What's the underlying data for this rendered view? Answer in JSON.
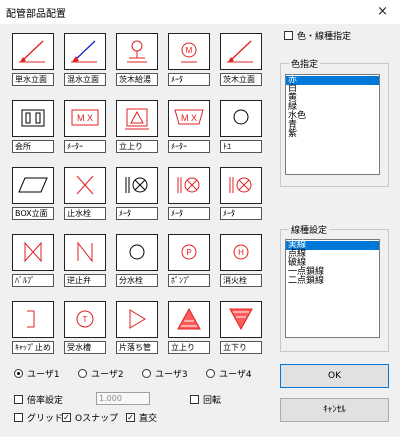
{
  "window": {
    "title": "配管部品配置",
    "close_glyph": "×"
  },
  "parts": [
    {
      "label": "単水立面",
      "icon": "diagonal-pipe-blue-icon"
    },
    {
      "label": "混水立面",
      "icon": "diagonal-pipe-mixed-icon"
    },
    {
      "label": "茨木給湯",
      "icon": "water-heater-icon"
    },
    {
      "label": "ﾒｰﾀ",
      "icon": "meter-circle-m-icon"
    },
    {
      "label": "茨木立面",
      "icon": "diagonal-pipe-red-icon"
    },
    {
      "label": "会所",
      "icon": "catch-basin-icon"
    },
    {
      "label": "ﾒｰﾀｰ",
      "icon": "mx-meter-icon"
    },
    {
      "label": "立上り",
      "icon": "riser-triangle-icon"
    },
    {
      "label": "ﾒｰﾀｰ",
      "icon": "mx-meter-triangle-icon"
    },
    {
      "label": "ﾄﾕ",
      "icon": "gutter-circle-icon"
    },
    {
      "label": "BOX立面",
      "icon": "box-parallelogram-icon"
    },
    {
      "label": "止水栓",
      "icon": "stop-cock-x-icon"
    },
    {
      "label": "ﾒｰﾀ",
      "icon": "meter-valve-blue-icon"
    },
    {
      "label": "ﾒｰﾀ",
      "icon": "meter-valve-mixed-icon"
    },
    {
      "label": "ﾒｰﾀ",
      "icon": "meter-valve-red-icon"
    },
    {
      "label": "ﾊﾞﾙﾌﾞ",
      "icon": "valve-icon"
    },
    {
      "label": "逆止弁",
      "icon": "check-valve-icon"
    },
    {
      "label": "分水栓",
      "icon": "branch-tap-circle-icon"
    },
    {
      "label": "ﾎﾟﾝﾌﾟ",
      "icon": "pump-circle-p-icon"
    },
    {
      "label": "消火栓",
      "icon": "fire-hydrant-circle-h-icon"
    },
    {
      "label": "ｷｬｯﾌﾟ止め",
      "icon": "cap-stop-bracket-icon"
    },
    {
      "label": "受水槽",
      "icon": "water-tank-circle-t-icon"
    },
    {
      "label": "片落ち管",
      "icon": "reducer-triangle-icon"
    },
    {
      "label": "立上り",
      "icon": "riser-filled-up-icon"
    },
    {
      "label": "立下り",
      "icon": "riser-filled-down-icon"
    }
  ],
  "icon_text": {
    "meter_m": "M",
    "mx": "M X",
    "pump_p": "P",
    "hydrant_h": "H",
    "tank_t": "T"
  },
  "color_option": {
    "label": "色・線種指定",
    "checked": false
  },
  "color_group": {
    "title": "色指定",
    "items": [
      "赤",
      "白",
      "黄",
      "緑",
      "水色",
      "青",
      "紫"
    ],
    "selected_index": 0
  },
  "line_group": {
    "title": "線種設定",
    "items": [
      "実線",
      "点線",
      "破線",
      "一点鎖線",
      "二点鎖線"
    ],
    "selected_index": 0
  },
  "users": {
    "options": [
      "ユーザ1",
      "ユーザ2",
      "ユーザ3",
      "ユーザ4"
    ],
    "selected_index": 0
  },
  "scale": {
    "label": "倍率設定",
    "checked": false,
    "value": "1.000"
  },
  "rotate": {
    "label": "回転",
    "checked": false
  },
  "grid": {
    "label": "グリッド",
    "checked": false
  },
  "osnap": {
    "label": "Oスナップ",
    "checked": true
  },
  "ortho": {
    "label": "直交",
    "checked": true
  },
  "buttons": {
    "ok": "OK",
    "cancel": "ｷｬﾝｾﾙ"
  },
  "check_mark": "✓",
  "colors": {
    "blue": "#1a24c9",
    "red": "#e02020",
    "pink": "#ff5a5a",
    "selection": "#0078d7"
  }
}
